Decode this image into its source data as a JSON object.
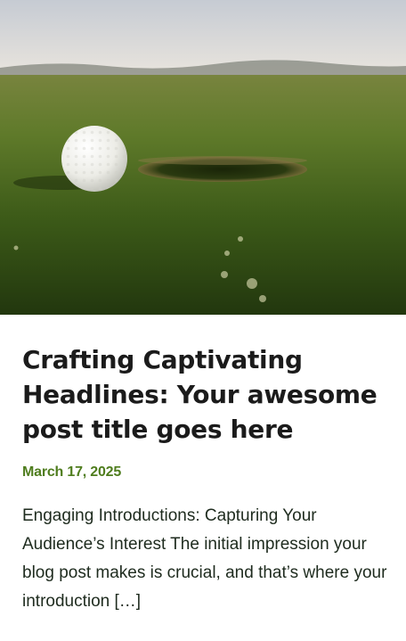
{
  "post": {
    "image": {
      "icon": "golf-ball-on-green-photo",
      "colors": {
        "sky_top": "#c9ccd2",
        "sky_bottom": "#e9e4dc",
        "grass_far": "#6d7b3f",
        "grass_mid": "#4c6a22",
        "grass_near": "#2b4412",
        "ball": "#f2f2ee"
      }
    },
    "title": "Crafting Captivating Headlines: Your awesome post title goes here",
    "date": "March 17, 2025",
    "excerpt": "Engaging Introductions: Capturing Your Audience’s Interest The initial impression your blog post makes is crucial, and that’s where your introduction […]"
  },
  "theme": {
    "title_color": "#1b1b1b",
    "date_color": "#4f7d1e",
    "text_color": "#1e2b1e"
  }
}
